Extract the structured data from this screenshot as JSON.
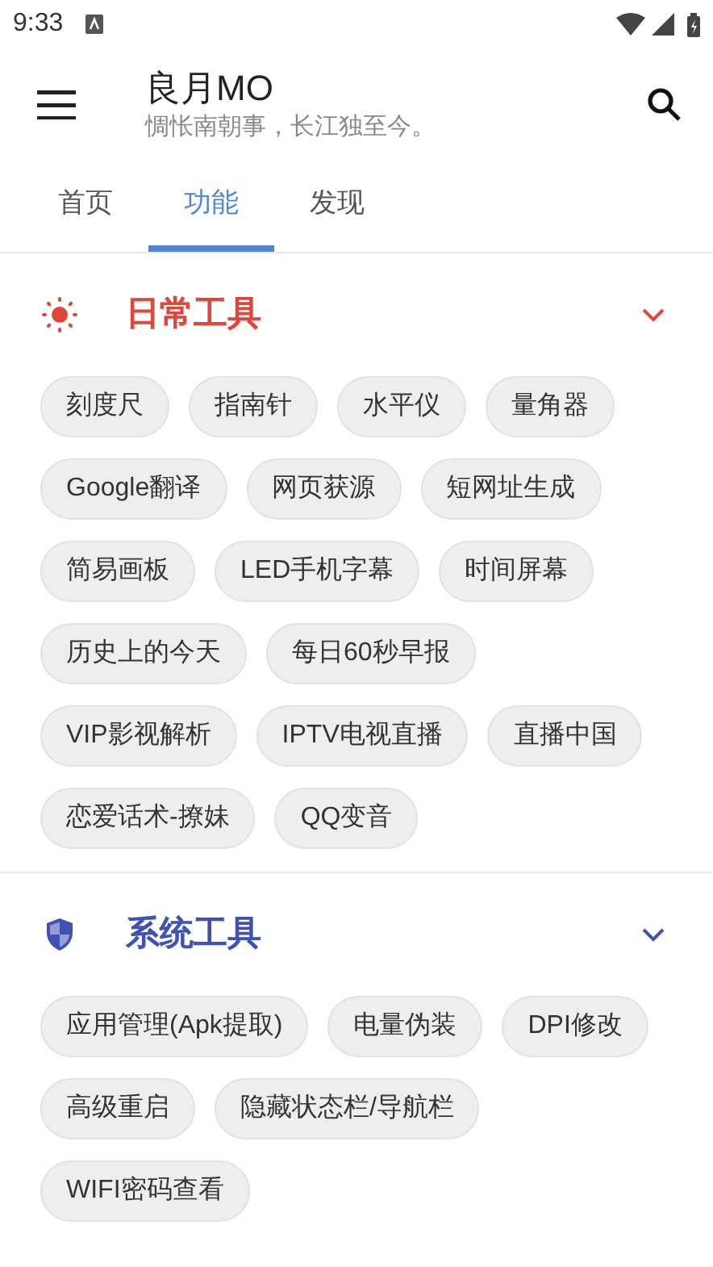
{
  "status_bar": {
    "time": "9:33"
  },
  "app_bar": {
    "title": "良月MO",
    "subtitle": "惆怅南朝事，长江独至今。"
  },
  "tabs": [
    {
      "label": "首页",
      "selected": false
    },
    {
      "label": "功能",
      "selected": true
    },
    {
      "label": "发现",
      "selected": false
    }
  ],
  "sections": [
    {
      "kind": "sun",
      "title": "日常工具",
      "color": "#e0463a",
      "expanded": true,
      "chips": [
        "刻度尺",
        "指南针",
        "水平仪",
        "量角器",
        "Google翻译",
        "网页获源",
        "短网址生成",
        "简易画板",
        "LED手机字幕",
        "时间屏幕",
        "历史上的今天",
        "每日60秒早报",
        "VIP影视解析",
        "IPTV电视直播",
        "直播中国",
        "恋爱话术-撩妹",
        "QQ变音"
      ]
    },
    {
      "kind": "shield",
      "title": "系统工具",
      "color": "#3f51b5",
      "expanded": true,
      "chips": [
        "应用管理(Apk提取)",
        "电量伪装",
        "DPI修改",
        "高级重启",
        "隐藏状态栏/导航栏",
        "WIFI密码查看"
      ]
    }
  ]
}
